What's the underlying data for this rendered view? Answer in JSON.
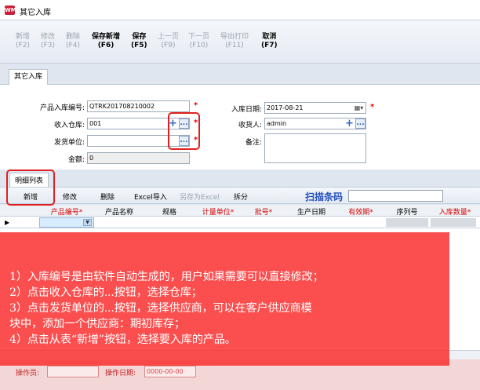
{
  "window": {
    "icon_text": "WMS",
    "title": "其它入库"
  },
  "toolbar": [
    {
      "label": "新增",
      "key": "(F2)",
      "enabled": false
    },
    {
      "label": "修改",
      "key": "(F3)",
      "enabled": false
    },
    {
      "label": "删除",
      "key": "(F4)",
      "enabled": false
    },
    {
      "label": "保存新增",
      "key": "(F6)",
      "enabled": true
    },
    {
      "label": "保存",
      "key": "(F5)",
      "enabled": true
    },
    {
      "label": "上一页",
      "key": "(F9)",
      "enabled": false
    },
    {
      "label": "下一页",
      "key": "(F10)",
      "enabled": false
    },
    {
      "label": "导出打印",
      "key": "(F11)",
      "enabled": false
    },
    {
      "label": "取消",
      "key": "(F7)",
      "enabled": true
    }
  ],
  "tab": {
    "label": "其它入库"
  },
  "form": {
    "receipt_no_label": "产品入库编号:",
    "receipt_no": "QTRK201708210002",
    "warehouse_label": "收入仓库:",
    "warehouse": "001",
    "supplier_label": "发货单位:",
    "supplier": "",
    "amount_label": "金额:",
    "amount": "0",
    "date_label": "入库日期:",
    "date": "2017-08-21",
    "receiver_label": "收货人:",
    "receiver": "admin",
    "remark_label": "备注:",
    "remark": "",
    "required_mark": "*",
    "ellipsis": "...",
    "plus": "+"
  },
  "detail": {
    "tab_label": "明细列表",
    "buttons": [
      {
        "label": "新增",
        "enabled": true
      },
      {
        "label": "修改",
        "enabled": true
      },
      {
        "label": "删除",
        "enabled": true
      },
      {
        "label": "Excel导入",
        "enabled": true
      },
      {
        "label": "另存为Excel",
        "enabled": false
      },
      {
        "label": "拆分",
        "enabled": true
      }
    ],
    "scan_label": "扫描条码",
    "columns": [
      {
        "label": "产品编号",
        "required": true
      },
      {
        "label": "产品名称",
        "required": false
      },
      {
        "label": "规格",
        "required": false
      },
      {
        "label": "计量单位",
        "required": true
      },
      {
        "label": "批号",
        "required": true
      },
      {
        "label": "生产日期",
        "required": false
      },
      {
        "label": "有效期",
        "required": true
      },
      {
        "label": "序列号",
        "required": false
      },
      {
        "label": "入库数量",
        "required": true
      }
    ]
  },
  "footer": {
    "operator_label": "操作员:",
    "operator": "",
    "opdate_label": "操作日期:",
    "opdate": "0000-00-00"
  },
  "annotation": {
    "lines": [
      "1）入库编号是由软件自动生成的，用户如果需要可以直接修改；",
      "2）点击收入仓库的...按钮，选择仓库；",
      "3）点击发货单位的...按钮，选择供应商，可以在客户供应商模",
      "块中，添加一个供应商：期初库存；",
      "4）点击从表“新增”按钮，选择要入库的产品。"
    ]
  },
  "colors": {
    "overlay": "#fa2828",
    "highlight": "#e02020",
    "scan_label": "#2550c0",
    "required": "#d40000"
  }
}
